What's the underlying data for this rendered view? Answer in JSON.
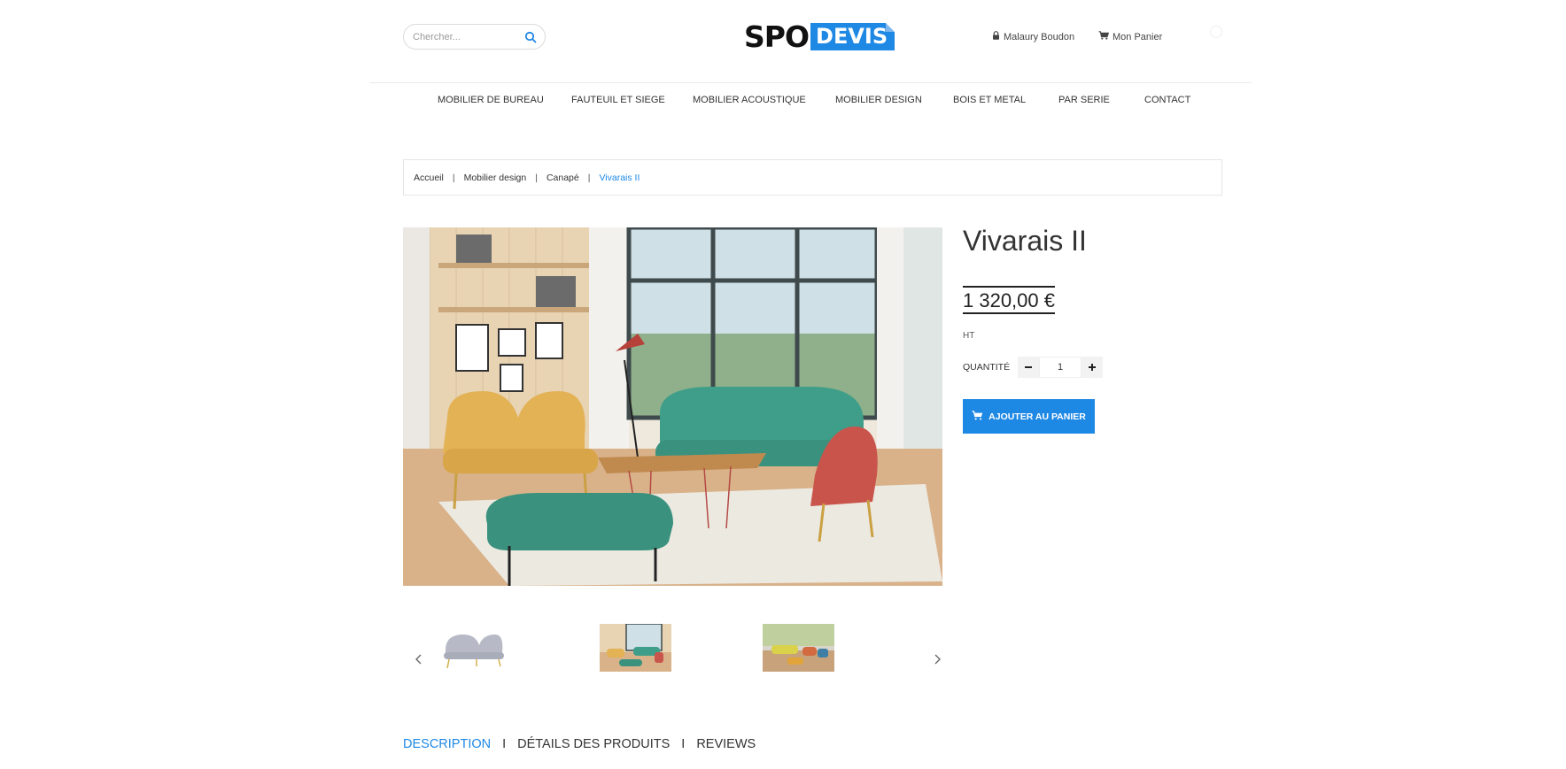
{
  "search": {
    "placeholder": "Chercher..."
  },
  "brand": {
    "part1": "SPO",
    "part2": "DEVIS"
  },
  "account": {
    "user_name": "Malaury Boudon",
    "cart_label": "Mon Panier"
  },
  "nav": {
    "items": [
      {
        "label": "MOBILIER DE BUREAU"
      },
      {
        "label": "FAUTEUIL ET SIEGE"
      },
      {
        "label": "MOBILIER ACOUSTIQUE"
      },
      {
        "label": "MOBILIER DESIGN"
      },
      {
        "label": "BOIS ET METAL"
      },
      {
        "label": "PAR SERIE"
      },
      {
        "label": "CONTACT"
      }
    ]
  },
  "breadcrumb": {
    "home": "Accueil",
    "category": "Mobilier design",
    "subcategory": "Canapé",
    "current": "Vivarais II"
  },
  "product": {
    "name": "Vivarais II",
    "price": "1 320,00 €",
    "tax_note": "HT",
    "quantity_label": "Quantité",
    "quantity": "1",
    "add_to_cart": "AJOUTER AU PANIER"
  },
  "tabs": [
    {
      "label": "DESCRIPTION"
    },
    {
      "label": "DÉTAILS DES PRODUITS"
    },
    {
      "label": "REVIEWS"
    }
  ],
  "colors": {
    "accent": "#1e88e5",
    "text": "#333333",
    "border": "#e6e6e6"
  },
  "icons": {
    "search": "search-icon",
    "lock": "lock-icon",
    "cart": "cart-icon",
    "prev": "chevron-left-icon",
    "next": "chevron-right-icon",
    "minus": "minus-icon",
    "plus": "plus-icon"
  }
}
